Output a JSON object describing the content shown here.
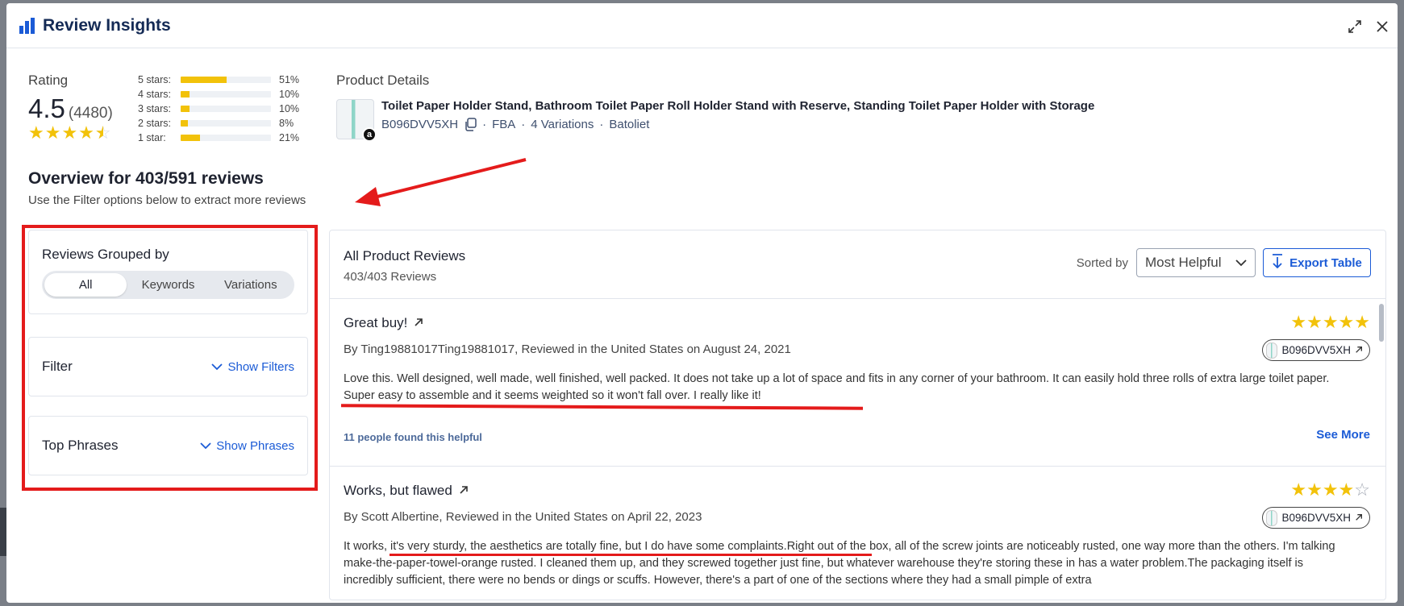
{
  "header": {
    "title": "Review Insights",
    "expand_icon": "expand-icon",
    "close_icon": "close-icon"
  },
  "rating": {
    "label": "Rating",
    "value": "4.5",
    "count": "(4480)",
    "stars_value": 4.5,
    "distribution": [
      {
        "label": "5 stars:",
        "pct": "51%",
        "fill": 0.51
      },
      {
        "label": "4 stars:",
        "pct": "10%",
        "fill": 0.1
      },
      {
        "label": "3 stars:",
        "pct": "10%",
        "fill": 0.1
      },
      {
        "label": "2 stars:",
        "pct": "8%",
        "fill": 0.08
      },
      {
        "label": "1 star:",
        "pct": "21%",
        "fill": 0.21
      }
    ]
  },
  "product": {
    "section_label": "Product Details",
    "name": "Toilet Paper Holder Stand, Bathroom Toilet Paper Roll Holder Stand with Reserve, Standing Toilet Paper Holder with Storage",
    "asin": "B096DVV5XH",
    "fulfillment": "FBA",
    "variations": "4 Variations",
    "brand": "Batoliet",
    "badge": "a"
  },
  "overview": {
    "title": "Overview for 403/591 reviews",
    "subtitle": "Use the Filter options below to extract more reviews"
  },
  "grouping": {
    "title": "Reviews Grouped by",
    "options": [
      "All",
      "Keywords",
      "Variations"
    ],
    "selected": "All"
  },
  "filter": {
    "title": "Filter",
    "action": "Show Filters"
  },
  "phrases": {
    "title": "Top Phrases",
    "action": "Show Phrases"
  },
  "reviews_panel": {
    "title": "All Product Reviews",
    "count": "403/403 Reviews",
    "sort_label": "Sorted by",
    "sort_value": "Most Helpful",
    "export_label": "Export Table"
  },
  "reviews": [
    {
      "title": "Great buy!",
      "rating": 5,
      "byline": "By Ting19881017Ting19881017, Reviewed in the United States on August 24, 2021",
      "asin": "B096DVV5XH",
      "body": "Love this. Well designed, well made, well finished, well packed. It does not take up a lot of space and fits in any corner of your bathroom. It can easily hold three rolls of extra large toilet paper. Super easy to assemble and it seems weighted so it won't fall over. I really like it!",
      "helpful": "11 people found this helpful",
      "see_more": "See More"
    },
    {
      "title": "Works, but flawed",
      "rating": 4,
      "byline": "By Scott Albertine, Reviewed in the United States on April 22, 2023",
      "asin": "B096DVV5XH",
      "body": "It works, it's very sturdy, the aesthetics are totally fine, but I do have some complaints.Right out of the box, all of the screw joints are noticeably rusted, one way more than the others. I'm talking make-the-paper-towel-orange rusted. I cleaned them up, and they screwed together just fine, but whatever warehouse they're storing these in has a water problem.The packaging itself is incredibly sufficient, there were no bends or dings or scuffs. However, there's a part of one of the sections where they had a small pimple of extra",
      "helpful": "",
      "see_more": ""
    }
  ],
  "colors": {
    "accent": "#1b5bd6",
    "star": "#f2c20a",
    "annotation": "#e41b1b"
  }
}
